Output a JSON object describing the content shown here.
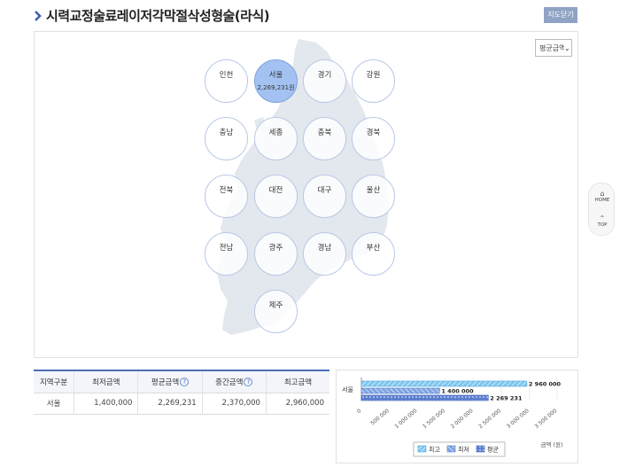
{
  "header": {
    "title": "시력교정술료레이저각막절삭성형술(라식)",
    "close_button": "지도닫기"
  },
  "filter": {
    "selected": "평균금액"
  },
  "regions": [
    {
      "name": "인천",
      "amount": ""
    },
    {
      "name": "서울",
      "amount": "2,269,231원",
      "active": true
    },
    {
      "name": "경기",
      "amount": ""
    },
    {
      "name": "강원",
      "amount": ""
    },
    {
      "name": "충남",
      "amount": ""
    },
    {
      "name": "세종",
      "amount": ""
    },
    {
      "name": "충북",
      "amount": ""
    },
    {
      "name": "경북",
      "amount": ""
    },
    {
      "name": "전북",
      "amount": ""
    },
    {
      "name": "대전",
      "amount": ""
    },
    {
      "name": "대구",
      "amount": ""
    },
    {
      "name": "울산",
      "amount": ""
    },
    {
      "name": "전남",
      "amount": ""
    },
    {
      "name": "광주",
      "amount": ""
    },
    {
      "name": "경남",
      "amount": ""
    },
    {
      "name": "부산",
      "amount": ""
    },
    {
      "name": "제주",
      "amount": ""
    }
  ],
  "side_nav": {
    "home": "HOME",
    "top": "TOP"
  },
  "table": {
    "headers": [
      "지역구분",
      "최저금액",
      "평균금액",
      "중간금액",
      "최고금액"
    ],
    "help_mark": "?",
    "rows": [
      [
        "서울",
        "1,400,000",
        "2,269,231",
        "2,370,000",
        "2,960,000"
      ]
    ]
  },
  "chart_data": {
    "type": "bar",
    "orientation": "horizontal",
    "categories": [
      "서울"
    ],
    "series": [
      {
        "name": "최고",
        "values": [
          2960000
        ],
        "label": "2 960 000",
        "color": "#4fb0e6"
      },
      {
        "name": "최저",
        "values": [
          1400000
        ],
        "label": "1 400 000",
        "color": "#5b8ad6"
      },
      {
        "name": "평균",
        "values": [
          2269231
        ],
        "label": "2 269 231",
        "color": "#3f64c4"
      }
    ],
    "x_ticks": [
      0,
      500000,
      1000000,
      1500000,
      2000000,
      2500000,
      3000000,
      3500000
    ],
    "x_tick_labels": [
      "0",
      "500 000",
      "1 000 000",
      "1 500 000",
      "2 000 000",
      "2 500 000",
      "3 000 000",
      "3 500 000"
    ],
    "xlim": [
      0,
      3500000
    ],
    "xlabel": "금액 (원)",
    "legend_position": "bottom"
  }
}
